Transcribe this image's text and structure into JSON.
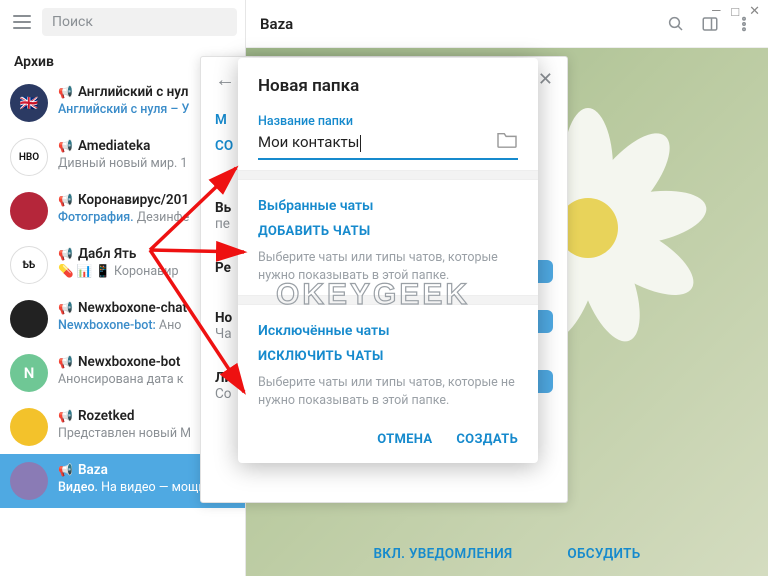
{
  "window": {
    "title": "Baza"
  },
  "search": {
    "placeholder": "Поиск"
  },
  "archive_header": "Архив",
  "chats": [
    {
      "name": "Английский с нул",
      "sub_prefix": "Английский с нуля – У",
      "sub_rest": "",
      "avatar_bg": "#2b3a63",
      "avatar_txt": "🇬🇧"
    },
    {
      "name": "Amediateka",
      "sub_prefix": "",
      "sub_rest": "Дивный новый мир. 1",
      "avatar_bg": "#ffffff",
      "avatar_txt": "HBO"
    },
    {
      "name": "Коронавирус/201",
      "sub_prefix": "Фотография. ",
      "sub_rest": "Дезинфе",
      "avatar_bg": "#b5263a",
      "avatar_txt": ""
    },
    {
      "name": "Дабл Ять",
      "sub_prefix": "",
      "sub_rest": "💊 📊 📱  Коронавир",
      "avatar_bg": "#ffffff",
      "avatar_txt": "ѢѢ"
    },
    {
      "name": "Newxboxone-chat",
      "sub_prefix": "Newxboxone-bot: ",
      "sub_rest": "Ано",
      "avatar_bg": "#222",
      "avatar_txt": ""
    },
    {
      "name": "Newxboxone-bot",
      "sub_prefix": "",
      "sub_rest": "Анонсирована дата к",
      "avatar_bg": "#6fc795",
      "avatar_txt": "N"
    },
    {
      "name": "Rozetked",
      "sub_prefix": "",
      "sub_rest": "Представлен новый M",
      "avatar_bg": "#f3c22b",
      "avatar_txt": ""
    },
    {
      "name": "Baza",
      "sub_prefix": "Видео. ",
      "sub_rest": "На видео — мощная",
      "avatar_bg": "#8a7bb5",
      "avatar_txt": "",
      "selected": true
    }
  ],
  "panel_behind": {
    "links": [
      "М",
      "СО"
    ],
    "rows": [
      {
        "label": "Вь",
        "sub": "пе"
      },
      {
        "label": "Ре"
      },
      {
        "label": "Но",
        "sub": "Ча"
      },
      {
        "label": "Ли",
        "sub": "Со"
      }
    ]
  },
  "modal": {
    "title": "Новая папка",
    "field_label": "Название папки",
    "field_value": "Мои контакты",
    "included": {
      "title": "Выбранные чаты",
      "action": "ДОБАВИТЬ ЧАТЫ",
      "desc": "Выберите чаты или типы чатов, которые нужно показывать в этой папке."
    },
    "excluded": {
      "title": "Исключённые чаты",
      "action": "ИСКЛЮЧИТЬ ЧАТЫ",
      "desc": "Выберите чаты или типы чатов, которые не нужно показывать в этой папке."
    },
    "cancel": "ОТМЕНА",
    "create": "СОЗДАТЬ"
  },
  "bottom_actions": {
    "left": "ВКЛ. УВЕДОМЛЕНИЯ",
    "right": "ОБСУДИТЬ"
  },
  "watermark": "OKEYGEEK"
}
